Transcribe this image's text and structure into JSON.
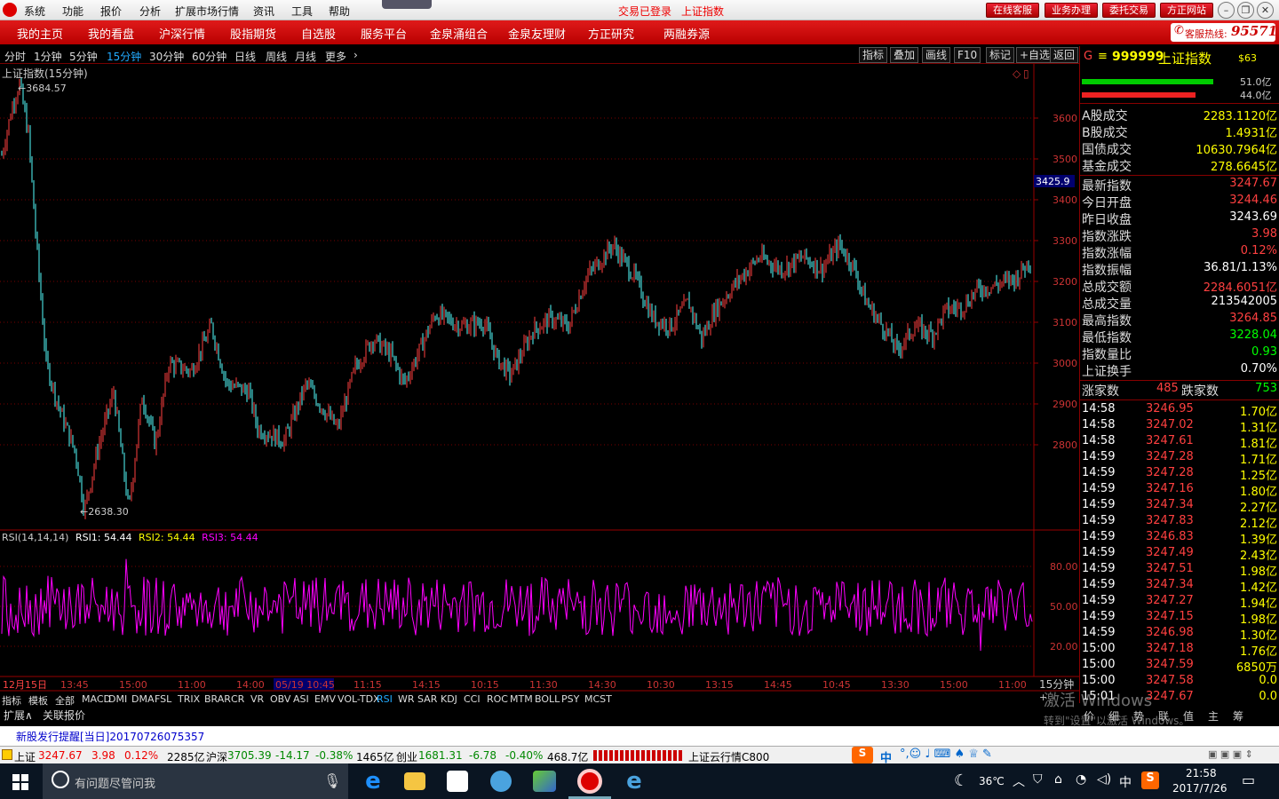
{
  "menu": {
    "items": [
      "系统",
      "功能",
      "报价",
      "分析",
      "扩展市场行情",
      "资讯",
      "工具",
      "帮助"
    ],
    "status_login": "交易已登录",
    "status_index": "上证指数",
    "buttons": [
      "在线客服",
      "业务办理",
      "委托交易",
      "方正网站"
    ]
  },
  "nav": {
    "items": [
      "我的主页",
      "我的看盘",
      "沪深行情",
      "股指期货",
      "自选股",
      "服务平台",
      "金泉涌组合",
      "金泉友理财",
      "方正研究",
      "两融券源"
    ],
    "hotline_label": "客服热线:",
    "hotline_number": "95571"
  },
  "periods": {
    "items": [
      "分时",
      "1分钟",
      "5分钟",
      "15分钟",
      "30分钟",
      "60分钟",
      "日线",
      "周线",
      "月线",
      "更多"
    ],
    "active": "15分钟"
  },
  "tools": [
    "指标",
    "叠加",
    "画线",
    "F10",
    "标记",
    "+自选",
    "返回"
  ],
  "chart": {
    "title": "上证指数(15分钟)",
    "max_label": "3684.57",
    "min_label": "2638.30",
    "cursor_price": "3425.9",
    "y_labels": [
      "3600",
      "3500",
      "3400",
      "3300",
      "3200",
      "3100",
      "3000",
      "2900",
      "2800"
    ],
    "rsi_header": "RSI(14,14,14)",
    "rsi1": "RSI1: 54.44",
    "rsi2": "RSI2: 54.44",
    "rsi3": "RSI3: 54.44",
    "rsi_labels": [
      "80.00",
      "50.00",
      "20.00"
    ],
    "x_labels": [
      "12月15日",
      "13:45",
      "15:00",
      "11:00",
      "14:00",
      "05/19 10:45",
      "11:15",
      "14:15",
      "10:15",
      "11:30",
      "14:30",
      "10:30",
      "13:15",
      "14:45",
      "10:45",
      "13:30",
      "15:00",
      "11:00"
    ],
    "period_tag": "15分钟"
  },
  "quote": {
    "code": "999999",
    "name": "上证指数",
    "tag": "$63",
    "bar_up": "51.0亿",
    "bar_down": "44.0亿",
    "volumes": [
      {
        "label": "A股成交",
        "value": "2283.1120亿"
      },
      {
        "label": "B股成交",
        "value": "1.4931亿"
      },
      {
        "label": "国债成交",
        "value": "10630.7964亿"
      },
      {
        "label": "基金成交",
        "value": "278.6645亿"
      }
    ],
    "stats": [
      {
        "label": "最新指数",
        "value": "3247.67"
      },
      {
        "label": "今日开盘",
        "value": "3244.46"
      },
      {
        "label": "昨日收盘",
        "value": "3243.69"
      },
      {
        "label": "指数涨跌",
        "value": "3.98"
      },
      {
        "label": "指数涨幅",
        "value": "0.12%"
      },
      {
        "label": "指数振幅",
        "value": "36.81/1.13%"
      },
      {
        "label": "总成交额",
        "value": "2284.6051亿"
      },
      {
        "label": "总成交量",
        "value": "213542005"
      },
      {
        "label": "最高指数",
        "value": "3264.85"
      },
      {
        "label": "最低指数",
        "value": "3228.04"
      },
      {
        "label": "指数量比",
        "value": "0.93"
      },
      {
        "label": "上证换手",
        "value": "0.70%"
      }
    ],
    "up_label": "涨家数",
    "up_count": "485",
    "down_label": "跌家数",
    "down_count": "753",
    "ticks": [
      [
        "14:58",
        "3246.95",
        "1.70亿"
      ],
      [
        "14:58",
        "3247.02",
        "1.31亿"
      ],
      [
        "14:58",
        "3247.61",
        "1.81亿"
      ],
      [
        "14:59",
        "3247.28",
        "1.71亿"
      ],
      [
        "14:59",
        "3247.28",
        "1.25亿"
      ],
      [
        "14:59",
        "3247.16",
        "1.80亿"
      ],
      [
        "14:59",
        "3247.34",
        "2.27亿"
      ],
      [
        "14:59",
        "3247.83",
        "2.12亿"
      ],
      [
        "14:59",
        "3246.83",
        "1.39亿"
      ],
      [
        "14:59",
        "3247.49",
        "2.43亿"
      ],
      [
        "14:59",
        "3247.51",
        "1.98亿"
      ],
      [
        "14:59",
        "3247.34",
        "1.42亿"
      ],
      [
        "14:59",
        "3247.27",
        "1.94亿"
      ],
      [
        "14:59",
        "3247.15",
        "1.98亿"
      ],
      [
        "14:59",
        "3246.98",
        "1.30亿"
      ],
      [
        "15:00",
        "3247.18",
        "1.76亿"
      ],
      [
        "15:00",
        "3247.59",
        "6850万"
      ],
      [
        "15:00",
        "3247.58",
        "0.0"
      ],
      [
        "15:01",
        "3247.67",
        "0.0"
      ]
    ],
    "bottom_tabs": [
      "价",
      "细",
      "势",
      "联",
      "值",
      "主",
      "筹"
    ]
  },
  "indicators": {
    "items": [
      "指标",
      "模板",
      "全部",
      "MACD",
      "DMI",
      "DMA",
      "FSL",
      "TRIX",
      "BRAR",
      "CR",
      "VR",
      "OBV",
      "ASI",
      "EMV",
      "VOL-TDX",
      "RSI",
      "WR",
      "SAR",
      "KDJ",
      "CCI",
      "ROC",
      "MTM",
      "BOLL",
      "PSY",
      "MCST"
    ],
    "active": "RSI",
    "row2": [
      "扩展∧",
      "关联报价"
    ]
  },
  "watermark": {
    "line1": "激活 Windows",
    "line2": "转到\"设置\"以激活 Windows。"
  },
  "notice": {
    "text": "新股发行提醒[当日]20170726075357"
  },
  "status": {
    "sh_name": "上证",
    "sh_price": "3247.67",
    "sh_chg": "3.98",
    "sh_pct": "0.12%",
    "sh_amt": "2285亿",
    "sz_name": "沪深",
    "sz_price": "3705.39",
    "sz_chg": "-14.17",
    "sz_pct": "-0.38%",
    "sz_amt": "1465亿",
    "cy_name": "创业",
    "cy_price": "1681.31",
    "cy_chg": "-6.78",
    "cy_pct": "-0.40%",
    "cy_amt": "468.7亿",
    "cloud": "上证云行情C800",
    "ime": "中"
  },
  "taskbar": {
    "search_placeholder": "有问题尽管问我",
    "weather": "36℃",
    "ime": "中",
    "time": "21:58",
    "date": "2017/7/26"
  }
}
